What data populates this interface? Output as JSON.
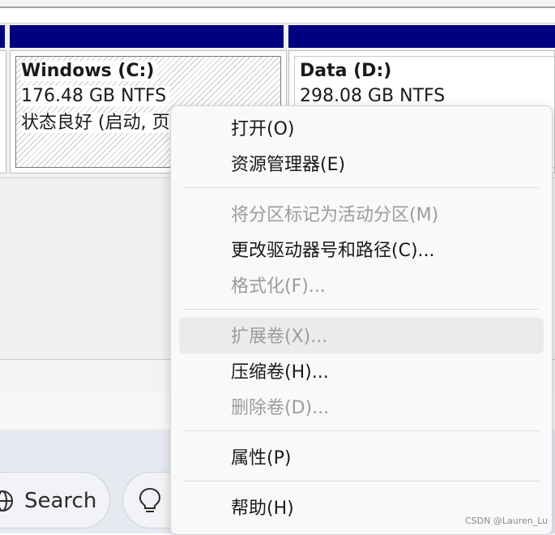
{
  "disks": {
    "c": {
      "title": "Windows (C:)",
      "size": "176.48 GB NTFS",
      "status": "状态良好 (启动, 页"
    },
    "d": {
      "title": "Data (D:)",
      "size": "298.08 GB NTFS"
    }
  },
  "context_menu": {
    "items": [
      {
        "label": "打开(O)",
        "enabled": true
      },
      {
        "label": "资源管理器(E)",
        "enabled": true
      },
      {
        "label": "将分区标记为活动分区(M)",
        "enabled": false
      },
      {
        "label": "更改驱动器号和路径(C)...",
        "enabled": true
      },
      {
        "label": "格式化(F)...",
        "enabled": false
      },
      {
        "label": "扩展卷(X)...",
        "enabled": false
      },
      {
        "label": "压缩卷(H)...",
        "enabled": true
      },
      {
        "label": "删除卷(D)...",
        "enabled": false
      },
      {
        "label": "属性(P)",
        "enabled": true
      },
      {
        "label": "帮助(H)",
        "enabled": true
      }
    ]
  },
  "taskbar": {
    "search_label": "Search",
    "search_icon": "globe-search-icon",
    "copilot_icon": "lightbulb-icon"
  },
  "watermark": "CSDN @Lauren_Lu",
  "colors": {
    "partition_bar": "#000080",
    "menu_bg": "#f9f9f9",
    "disabled_text": "#9c9c9c"
  }
}
